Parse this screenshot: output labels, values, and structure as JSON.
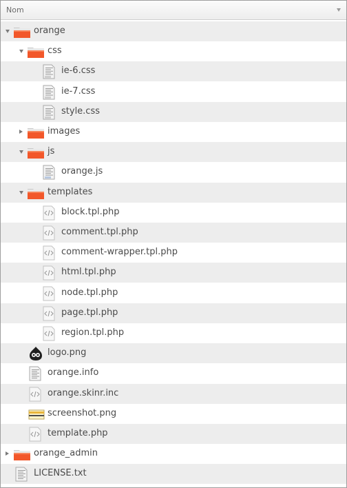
{
  "header": {
    "column_label": "Nom"
  },
  "colors": {
    "folder": "#f2572a",
    "folder_light": "#f7845a",
    "stripe": "#ededed",
    "text": "#4a4a4a"
  },
  "rows": [
    {
      "label": "orange",
      "icon": "folder-icon",
      "expander": "open"
    },
    {
      "label": "css",
      "icon": "folder-icon",
      "expander": "open"
    },
    {
      "label": "ie-6.css",
      "icon": "css-file-icon",
      "expander": ""
    },
    {
      "label": "ie-7.css",
      "icon": "css-file-icon",
      "expander": ""
    },
    {
      "label": "style.css",
      "icon": "css-file-icon",
      "expander": ""
    },
    {
      "label": "images",
      "icon": "folder-icon",
      "expander": "closed"
    },
    {
      "label": "js",
      "icon": "folder-icon",
      "expander": "open"
    },
    {
      "label": "orange.js",
      "icon": "js-file-icon",
      "expander": ""
    },
    {
      "label": "templates",
      "icon": "folder-icon",
      "expander": "open"
    },
    {
      "label": "block.tpl.php",
      "icon": "code-file-icon",
      "expander": ""
    },
    {
      "label": "comment.tpl.php",
      "icon": "code-file-icon",
      "expander": ""
    },
    {
      "label": "comment-wrapper.tpl.php",
      "icon": "code-file-icon",
      "expander": ""
    },
    {
      "label": "html.tpl.php",
      "icon": "code-file-icon",
      "expander": ""
    },
    {
      "label": "node.tpl.php",
      "icon": "code-file-icon",
      "expander": ""
    },
    {
      "label": "page.tpl.php",
      "icon": "code-file-icon",
      "expander": ""
    },
    {
      "label": "region.tpl.php",
      "icon": "code-file-icon",
      "expander": ""
    },
    {
      "label": "logo.png",
      "icon": "drupal-logo-icon",
      "expander": ""
    },
    {
      "label": "orange.info",
      "icon": "text-file-icon",
      "expander": ""
    },
    {
      "label": "orange.skinr.inc",
      "icon": "code-file-icon",
      "expander": ""
    },
    {
      "label": "screenshot.png",
      "icon": "image-file-icon",
      "expander": ""
    },
    {
      "label": "template.php",
      "icon": "code-file-icon",
      "expander": ""
    },
    {
      "label": "orange_admin",
      "icon": "folder-icon",
      "expander": "closed"
    },
    {
      "label": "LICENSE.txt",
      "icon": "text-file-icon",
      "expander": ""
    }
  ]
}
